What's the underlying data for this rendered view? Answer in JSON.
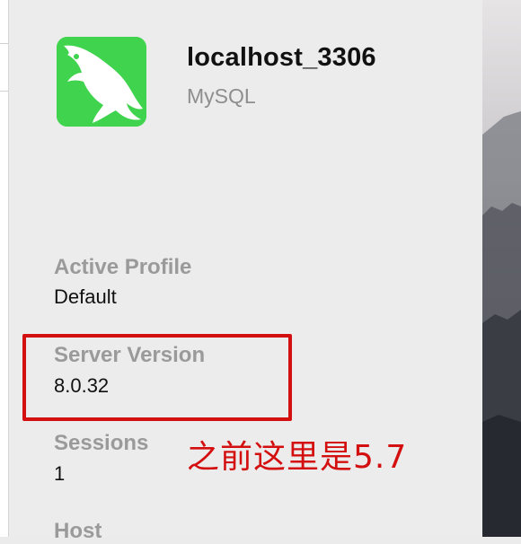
{
  "connection": {
    "name": "localhost_3306",
    "type": "MySQL",
    "icon": "mysql-dolphin-icon",
    "icon_color": "#3fd34e"
  },
  "details": [
    {
      "label": "Active Profile",
      "value": "Default"
    },
    {
      "label": "Server Version",
      "value": "8.0.32"
    },
    {
      "label": "Sessions",
      "value": "1"
    },
    {
      "label": "Host",
      "value": ""
    }
  ],
  "annotation": {
    "text": "之前这里是5.7",
    "color": "#d40f0f"
  }
}
